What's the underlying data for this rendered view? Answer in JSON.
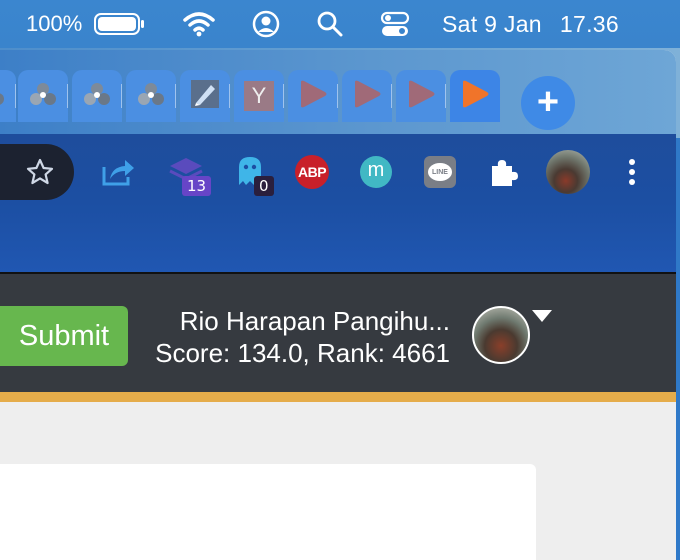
{
  "menubar": {
    "battery_percent": "100%",
    "date": "Sat 9 Jan",
    "time": "17.36",
    "icons": [
      "battery-icon",
      "wifi-icon",
      "user-account-icon",
      "spotlight-search-icon",
      "control-center-icon"
    ]
  },
  "tabs": {
    "favicons": [
      "network-favicon",
      "network-favicon",
      "network-favicon",
      "network-favicon",
      "pencil-favicon",
      "y-favicon",
      "play-favicon",
      "play-favicon",
      "play-favicon",
      "play-favicon"
    ],
    "y_label": "Y",
    "new_tab_label": "+"
  },
  "toolbar": {
    "extensions": [
      {
        "name": "share-extension"
      },
      {
        "name": "stack-extension",
        "badge": "13"
      },
      {
        "name": "ghostery-extension",
        "badge": "0"
      },
      {
        "name": "adblock-plus-extension",
        "label": "ABP"
      },
      {
        "name": "m-extension",
        "label": "m"
      },
      {
        "name": "line-extension",
        "label": "LINE"
      },
      {
        "name": "extensions-puzzle"
      }
    ]
  },
  "site": {
    "submit_label": "Submit",
    "user_name": "Rio Harapan Pangihu...",
    "score_text": "Score: 134.0, Rank: 4661"
  },
  "colors": {
    "accent_blue": "#3d85e6",
    "toolbar_blue": "#1e4d9c",
    "submit_green": "#67b74e",
    "header_dark": "#363a40",
    "gold": "#e5ac4a"
  }
}
